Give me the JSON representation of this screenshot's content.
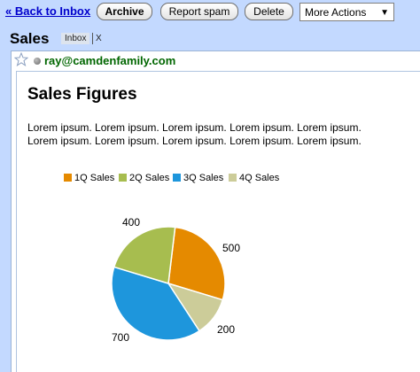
{
  "toolbar": {
    "back_link": "« Back to Inbox",
    "archive": "Archive",
    "report_spam": "Report spam",
    "delete": "Delete",
    "more_actions": "More Actions"
  },
  "conversation": {
    "subject": "Sales",
    "label": "Inbox",
    "label_remove": "X"
  },
  "message": {
    "sender": "ray@camdenfamily.com",
    "heading": "Sales Figures",
    "paragraph_lines": [
      "Lorem ipsum. Lorem ipsum. Lorem ipsum. Lorem ipsum. Lorem ipsum.",
      "Lorem ipsum. Lorem ipsum. Lorem ipsum. Lorem ipsum. Lorem ipsum."
    ]
  },
  "colors": {
    "q1": "#e58a00",
    "q2": "#a7bd4f",
    "q3": "#1e96dc",
    "q4": "#cccc99"
  },
  "chart_data": {
    "type": "pie",
    "categories": [
      "1Q Sales",
      "2Q Sales",
      "3Q Sales",
      "4Q Sales"
    ],
    "values": [
      500,
      400,
      700,
      200
    ],
    "legend_position": "top"
  }
}
